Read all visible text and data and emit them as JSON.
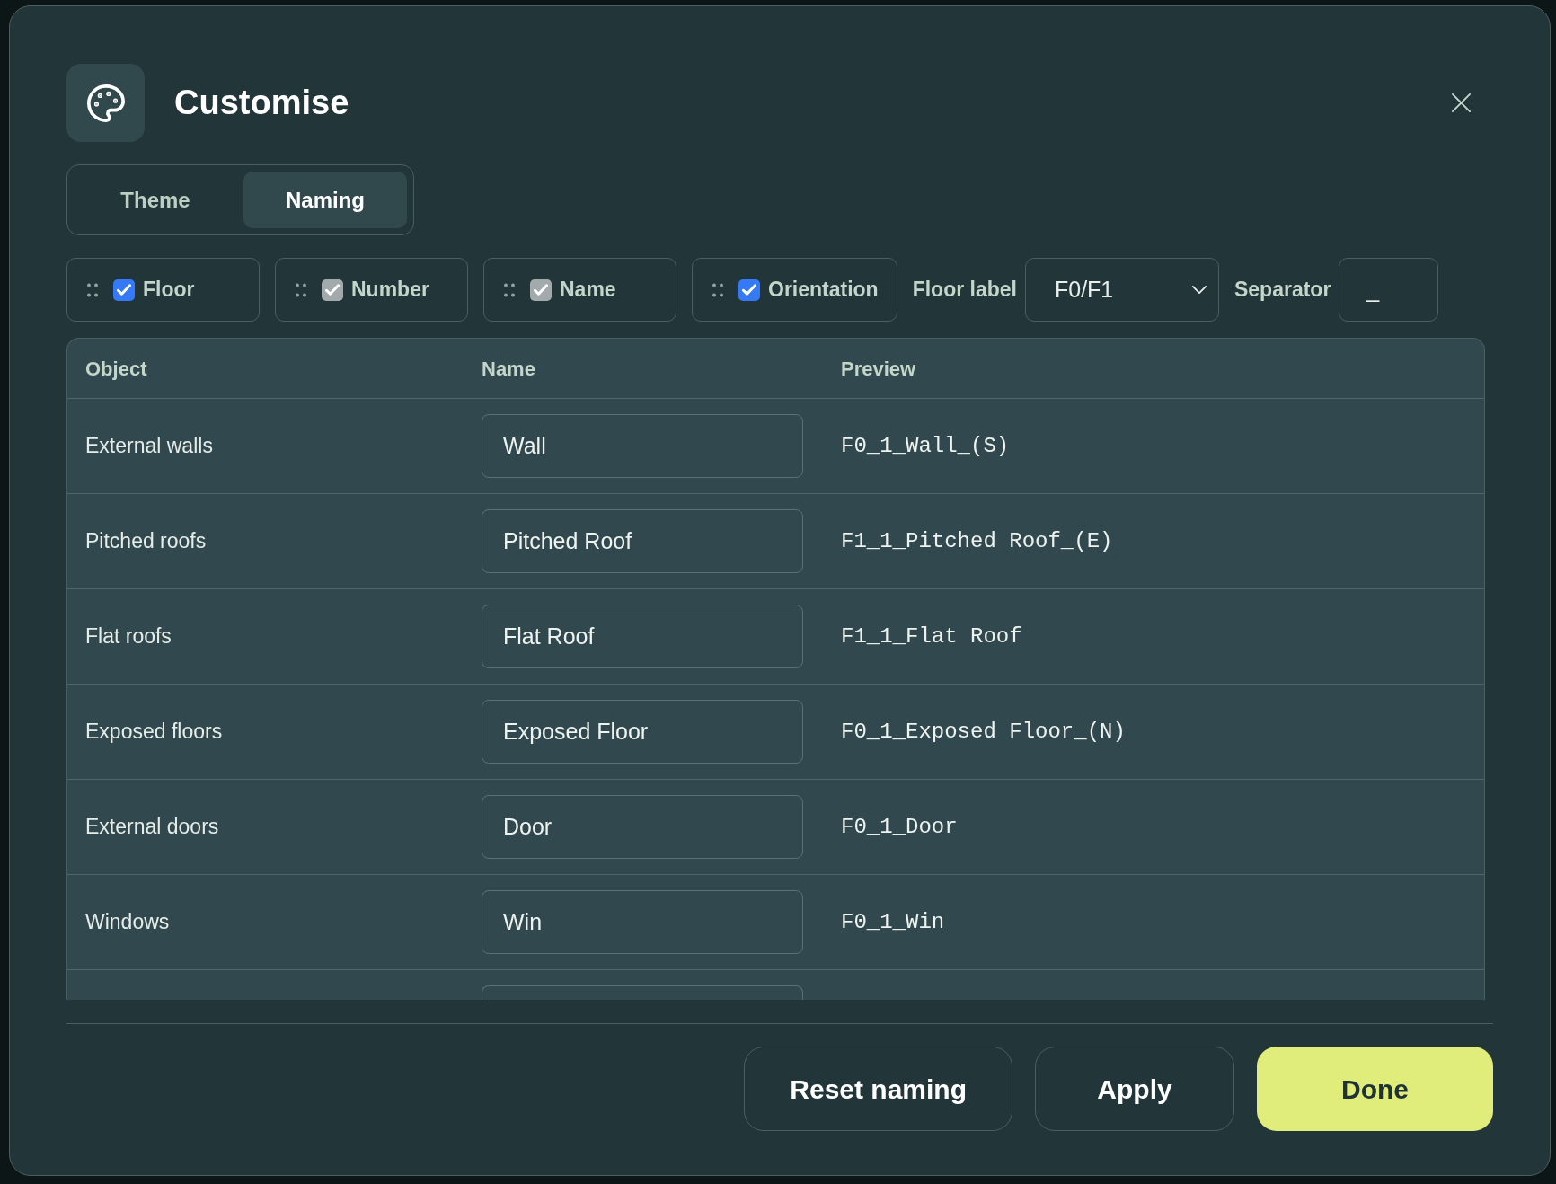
{
  "dialog": {
    "title": "Customise"
  },
  "tabs": [
    {
      "label": "Theme",
      "selected": false
    },
    {
      "label": "Naming",
      "selected": true
    }
  ],
  "name_parts": [
    {
      "label": "Floor",
      "checked": true,
      "disabled": false
    },
    {
      "label": "Number",
      "checked": true,
      "disabled": true
    },
    {
      "label": "Name",
      "checked": true,
      "disabled": true
    },
    {
      "label": "Orientation",
      "checked": true,
      "disabled": false
    }
  ],
  "floor_label": {
    "label": "Floor label",
    "value": "F0/F1"
  },
  "separator": {
    "label": "Separator",
    "value": "_"
  },
  "table": {
    "columns": [
      "Object",
      "Name",
      "Preview"
    ],
    "rows": [
      {
        "object": "External walls",
        "name": "Wall",
        "preview": "F0_1_Wall_(S)"
      },
      {
        "object": "Pitched roofs",
        "name": "Pitched Roof",
        "preview": "F1_1_Pitched Roof_(E)"
      },
      {
        "object": "Flat roofs",
        "name": "Flat Roof",
        "preview": "F1_1_Flat Roof"
      },
      {
        "object": "Exposed floors",
        "name": "Exposed Floor",
        "preview": "F0_1_Exposed Floor_(N)"
      },
      {
        "object": "External doors",
        "name": "Door",
        "preview": "F0_1_Door"
      },
      {
        "object": "Windows",
        "name": "Win",
        "preview": "F0_1_Win"
      }
    ]
  },
  "buttons": [
    {
      "label": "Reset naming",
      "kind": "secondary"
    },
    {
      "label": "Apply",
      "kind": "secondary"
    },
    {
      "label": "Done",
      "kind": "primary"
    }
  ]
}
